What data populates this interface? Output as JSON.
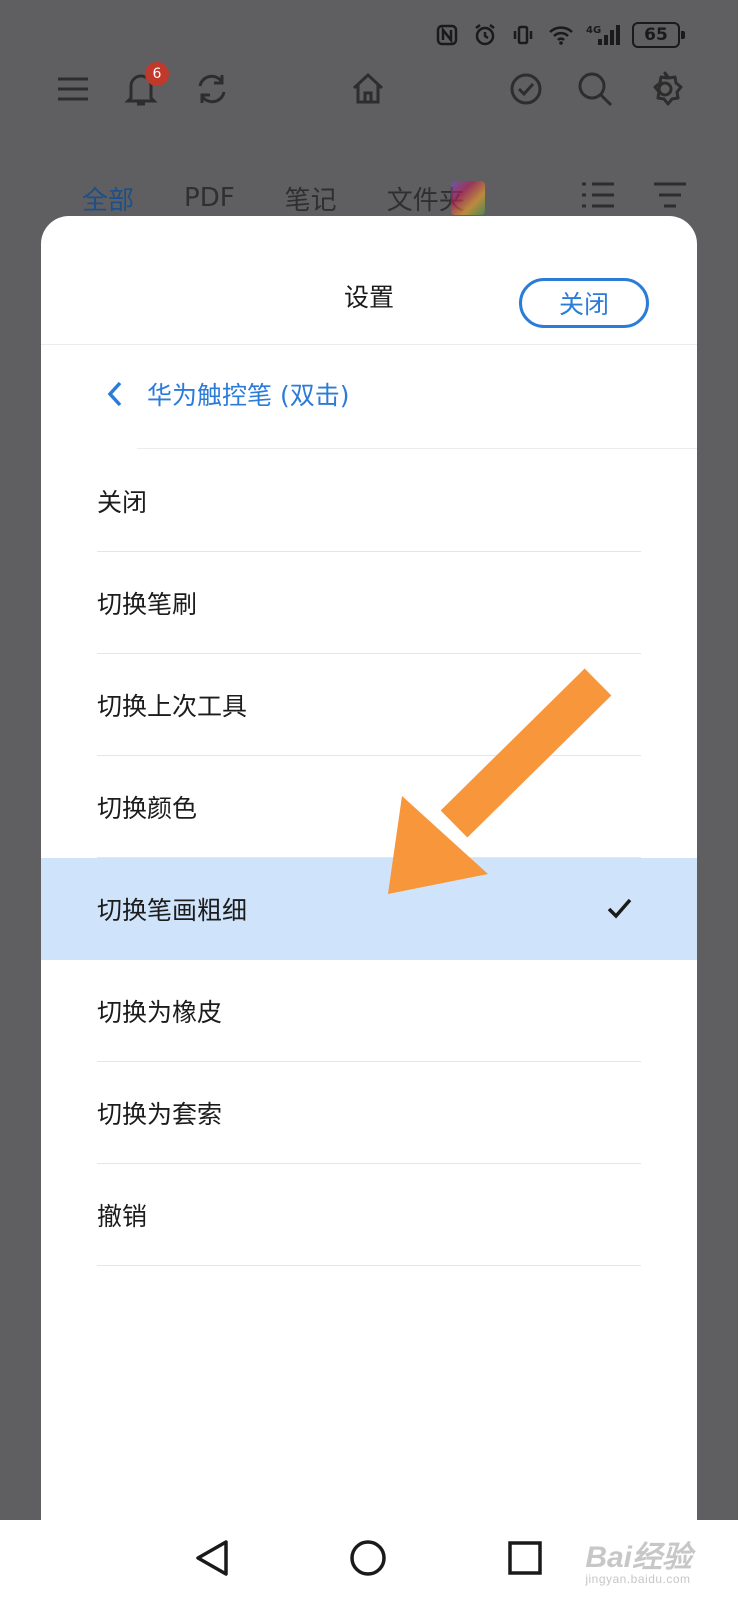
{
  "status_bar": {
    "battery": "65",
    "network": "4G"
  },
  "toolbar": {
    "notification_count": "6"
  },
  "tabs": [
    {
      "label": "全部",
      "active": true
    },
    {
      "label": "PDF",
      "active": false
    },
    {
      "label": "笔记",
      "active": false
    },
    {
      "label": "文件夹",
      "active": false
    }
  ],
  "sheet": {
    "title": "设置",
    "close_label": "关闭",
    "back_label": "华为触控笔 (双击)",
    "options": [
      {
        "label": "关闭",
        "selected": false
      },
      {
        "label": "切换笔刷",
        "selected": false
      },
      {
        "label": "切换上次工具",
        "selected": false
      },
      {
        "label": "切换颜色",
        "selected": false
      },
      {
        "label": "切换笔画粗细",
        "selected": true
      },
      {
        "label": "切换为橡皮",
        "selected": false
      },
      {
        "label": "切换为套索",
        "selected": false
      },
      {
        "label": "撤销",
        "selected": false
      }
    ]
  },
  "watermark": {
    "brand": "Bai经验",
    "url": "jingyan.baidu.com"
  },
  "colors": {
    "accent": "#2b7cd8",
    "selected_bg": "#cfe4fa",
    "arrow": "#f7963b",
    "overlay": "#5f5f61"
  }
}
